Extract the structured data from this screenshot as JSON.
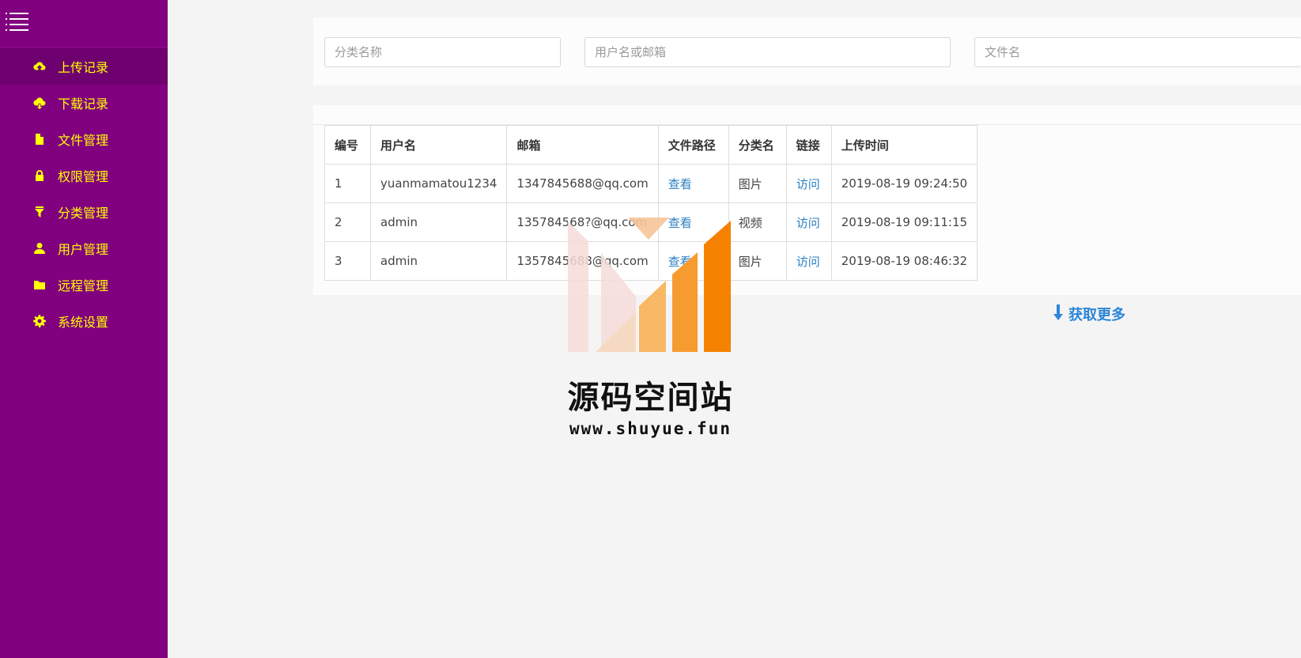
{
  "sidebar": {
    "toggle_icon": "menu-icon",
    "accent_color": "#ffff00",
    "background_color": "#800080",
    "items": [
      {
        "label": "上传记录",
        "icon": "cloud-upload-icon"
      },
      {
        "label": "下载记录",
        "icon": "cloud-download-icon"
      },
      {
        "label": "文件管理",
        "icon": "file-icon"
      },
      {
        "label": "权限管理",
        "icon": "lock-icon"
      },
      {
        "label": "分类管理",
        "icon": "filter-icon"
      },
      {
        "label": "用户管理",
        "icon": "user-icon"
      },
      {
        "label": "远程管理",
        "icon": "folder-icon"
      },
      {
        "label": "系统设置",
        "icon": "gear-icon"
      }
    ]
  },
  "search": {
    "category_placeholder": "分类名称",
    "user_placeholder": "用户名或邮箱",
    "file_placeholder": "文件名"
  },
  "table": {
    "headers": [
      "编号",
      "用户名",
      "邮箱",
      "文件路径",
      "分类名",
      "链接",
      "上传时间"
    ],
    "rows": [
      {
        "id": "1",
        "user": "yuanmamatou1234",
        "email": "1347845688@qq.com",
        "path": "查看",
        "category": "图片",
        "link": "访问",
        "time": "2019-08-19 09:24:50"
      },
      {
        "id": "2",
        "user": "admin",
        "email": "135784568?@qq.com",
        "path": "查看",
        "category": "视频",
        "link": "访问",
        "time": "2019-08-19 09:11:15"
      },
      {
        "id": "3",
        "user": "admin",
        "email": "1357845688@qq.com",
        "path": "查看",
        "category": "图片",
        "link": "访问",
        "time": "2019-08-19 08:46:32"
      }
    ],
    "link_color": "#2b7fc0"
  },
  "load_more": {
    "label": "获取更多",
    "icon": "arrow-down-icon"
  },
  "watermark": {
    "title": "源码空间站",
    "url": "www.shuyue.fun"
  }
}
